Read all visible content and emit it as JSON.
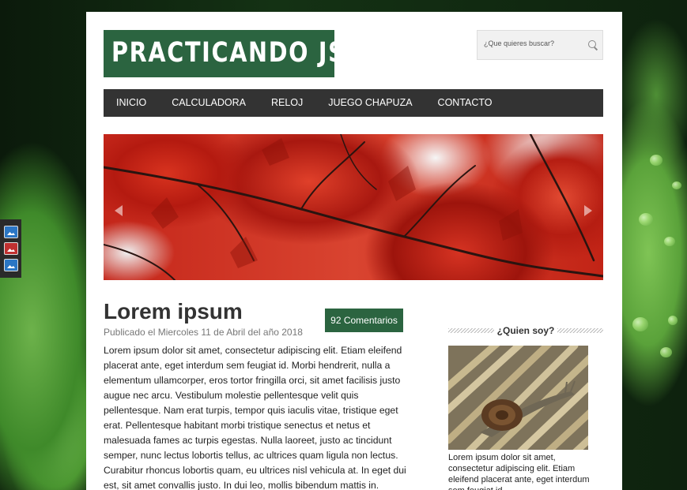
{
  "site": {
    "logo_text": "PRACTICANDO JS",
    "search": {
      "placeholder": "¿Que quieres buscar?"
    },
    "nav": [
      "INICIO",
      "CALCULADORA",
      "RELOJ",
      "JUEGO CHAPUZA",
      "CONTACTO"
    ]
  },
  "post": {
    "title": "Lorem ipsum",
    "meta": "Publicado el Miercoles 11 de Abril del año 2018",
    "comments": "92 Comentarios",
    "body": "Lorem ipsum dolor sit amet, consectetur adipiscing elit. Etiam eleifend placerat ante, eget interdum sem feugiat id. Morbi hendrerit, nulla a elementum ullamcorper, eros tortor fringilla orci, sit amet facilisis justo augue nec arcu. Vestibulum molestie pellentesque velit quis pellentesque. Nam erat turpis, tempor quis iaculis vitae, tristique eget erat. Pellentesque habitant morbi tristique senectus et netus et malesuada fames ac turpis egestas. Nulla laoreet, justo ac tincidunt semper, nunc lectus lobortis tellus, ac ultrices quam ligula non lectus. Curabitur rhoncus lobortis quam, eu ultrices nisl vehicula at. In eget dui est, sit amet convallis justo. In dui leo, mollis bibendum mattis in."
  },
  "sidebar": {
    "heading": "¿Quien soy?",
    "caption": "Lorem ipsum dolor sit amet, consectetur adipiscing elit. Etiam eleifend placerat ante, eget interdum sem feugiat id."
  },
  "colors": {
    "brand": "#2b6440",
    "nav_bg": "#333333"
  }
}
